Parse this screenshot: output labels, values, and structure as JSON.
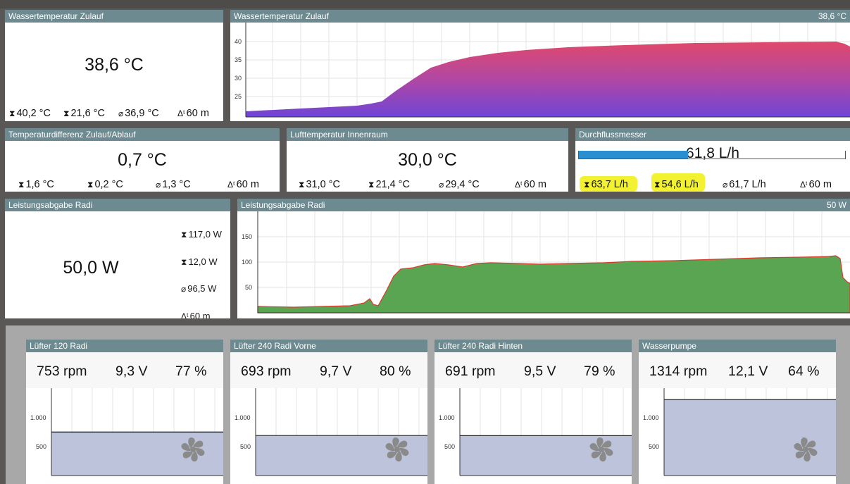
{
  "water_temp_tile": {
    "title": "Wassertemperatur Zulauf",
    "value": "38,6 °C",
    "max": "40,2 °C",
    "min": "21,6 °C",
    "avg": "36,9 °C",
    "period": "60 m"
  },
  "water_temp_chart": {
    "title": "Wassertemperatur Zulauf",
    "current": "38,6 °C",
    "yticks": [
      "40",
      "35",
      "30",
      "25"
    ]
  },
  "temp_diff": {
    "title": "Temperaturdifferenz Zulauf/Ablauf",
    "value": "0,7 °C",
    "max": "1,6 °C",
    "min": "0,2 °C",
    "avg": "1,3 °C",
    "period": "60 m"
  },
  "air_temp": {
    "title": "Lufttemperatur Innenraum",
    "value": "30,0 °C",
    "max": "31,0 °C",
    "min": "21,4 °C",
    "avg": "29,4 °C",
    "period": "60 m"
  },
  "flow": {
    "title": "Durchflussmesser",
    "value": "61,8 L/h",
    "fill_fraction": 0.41,
    "max": "63,7 L/h",
    "min": "54,6 L/h",
    "avg": "61,7 L/h",
    "period": "60 m",
    "bar_color": "#2a8fd0",
    "highlight_color": "#f2f230"
  },
  "power_tile": {
    "title": "Leistungsabgabe Radi",
    "value": "50,0 W",
    "max": "117,0 W",
    "min": "12,0 W",
    "avg": "96,5 W",
    "period": "60 m"
  },
  "power_chart": {
    "title": "Leistungsabgabe Radi",
    "current": "50 W",
    "yticks": [
      "150",
      "100",
      "50"
    ],
    "fill_color": "#5aa552",
    "line_color": "#d93a2b"
  },
  "fans": [
    {
      "title": "Lüfter 120 Radi",
      "rpm": "753 rpm",
      "volt": "9,3 V",
      "pct": "77 %",
      "level": 753
    },
    {
      "title": "Lüfter 240 Radi Vorne",
      "rpm": "693 rpm",
      "volt": "9,7 V",
      "pct": "80 %",
      "level": 693
    },
    {
      "title": "Lüfter 240 Radi Hinten",
      "rpm": "691 rpm",
      "volt": "9,5 V",
      "pct": "79 %",
      "level": 691
    },
    {
      "title": "Wasserpumpe",
      "rpm": "1314 rpm",
      "volt": "12,1 V",
      "pct": "64 %",
      "level": 1314
    }
  ],
  "fan_yticks": [
    "1.000",
    "500"
  ],
  "fan_icon": "fan-icon",
  "stat_icons": {
    "max": "max-icon",
    "min": "min-icon",
    "avg": "average-icon",
    "period": "delta-t-icon"
  }
}
